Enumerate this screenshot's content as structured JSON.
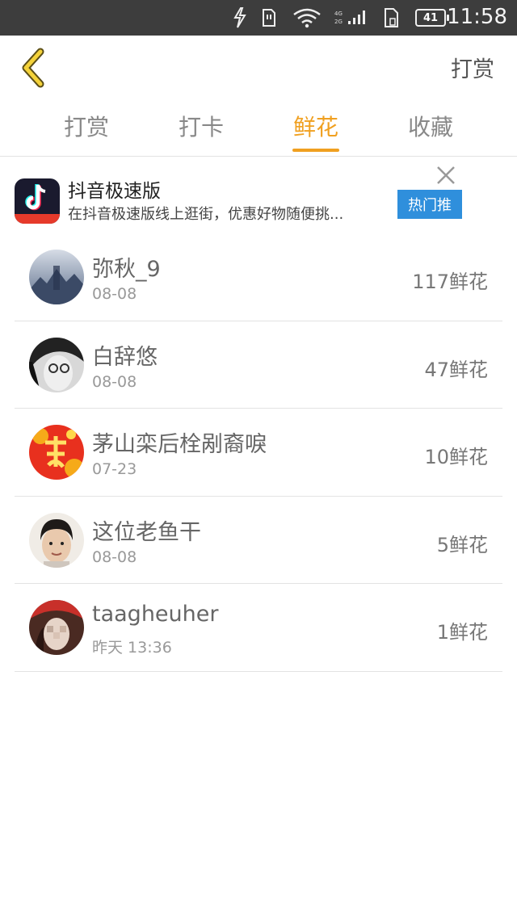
{
  "status_bar": {
    "time": "11:58",
    "battery": "41",
    "network_top": "4G",
    "network_bottom": "2G"
  },
  "header": {
    "back_icon": "chevron-left-icon",
    "right_label": "打赏"
  },
  "tabs": [
    {
      "label": "打赏",
      "active": false
    },
    {
      "label": "打卡",
      "active": false
    },
    {
      "label": "鲜花",
      "active": true
    },
    {
      "label": "收藏",
      "active": false
    }
  ],
  "ad": {
    "title": "抖音极速版",
    "description": "在抖音极速版线上逛街，优惠好物随便挑...",
    "button_label": "热门推",
    "close_icon": "close-icon"
  },
  "flower_list": [
    {
      "name": "弥秋_9",
      "date": "08-08",
      "amount": "117鲜花"
    },
    {
      "name": "白辞悠",
      "date": "08-08",
      "amount": "47鲜花"
    },
    {
      "name": "茅山栾后栓剐裔唳",
      "date": "07-23",
      "amount": "10鲜花"
    },
    {
      "name": "这位老鱼干",
      "date": "08-08",
      "amount": "5鲜花"
    },
    {
      "name": "taagheuher",
      "date": "昨天 13:36",
      "amount": "1鲜花"
    }
  ],
  "colors": {
    "accent": "#f0a020",
    "ad_button": "#2f8fdc",
    "status_bar": "#3d3d3d"
  }
}
